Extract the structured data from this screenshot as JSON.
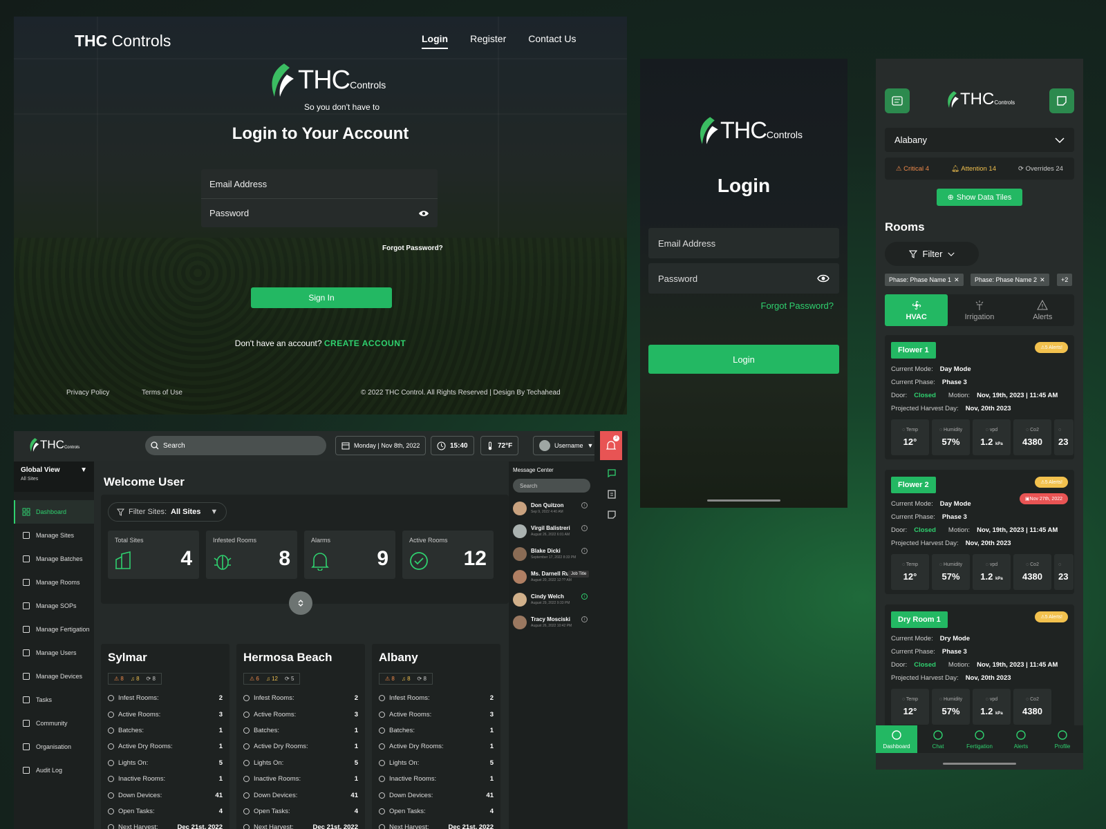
{
  "desktop_login": {
    "brand_bold": "THC",
    "brand_rest": " Controls",
    "nav": [
      "Login",
      "Register",
      "Contact Us"
    ],
    "logo_main": "THC",
    "logo_small": "Controls",
    "tagline": "So you don't have to",
    "title": "Login to Your Account",
    "email_placeholder": "Email Address",
    "password_placeholder": "Password",
    "forgot": "Forgot Password?",
    "sign_in": "Sign In",
    "no_account": "Don't have an account?",
    "create": "CREATE ACCOUNT",
    "footer": {
      "privacy": "Privacy Policy",
      "terms": "Terms of Use",
      "copyright": "© 2022 THC Control. All Rights Reserved | Design By Techahead"
    }
  },
  "mobile_login": {
    "logo_main": "THC",
    "logo_small": "Controls",
    "title": "Login",
    "email": "Email Address",
    "password": "Password",
    "forgot": "Forgot Password?",
    "button": "Login"
  },
  "dashboard": {
    "logo_main": "THC",
    "logo_small": "Controls",
    "search": "Search",
    "date": "Monday | Nov 8th, 2022",
    "time": "15:40",
    "temp": "72°F",
    "user": "Username",
    "bell_count": "3",
    "view": {
      "title": "Global View",
      "sub": "All Sites"
    },
    "nav": [
      "Dashboard",
      "Manage Sites",
      "Manage Batches",
      "Manage Rooms",
      "Manage SOPs",
      "Manage Fertigation",
      "Manage Users",
      "Manage Devices",
      "Tasks",
      "Community",
      "Organisation",
      "Audit Log"
    ],
    "welcome": "Welcome User",
    "filter_label": "Filter Sites:",
    "filter_value": "All Sites",
    "stats": [
      {
        "label": "Total Sites",
        "value": "4"
      },
      {
        "label": "Infested Rooms",
        "value": "8"
      },
      {
        "label": "Alarms",
        "value": "9"
      },
      {
        "label": "Active Rooms",
        "value": "12"
      }
    ],
    "sites": [
      {
        "name": "Sylmar",
        "badges": [
          "8",
          "8",
          "8"
        ],
        "rows": [
          [
            "Infest Rooms:",
            "2"
          ],
          [
            "Active Rooms:",
            "3"
          ],
          [
            "Batches:",
            "1"
          ],
          [
            "Active Dry Rooms:",
            "1"
          ],
          [
            "Lights On:",
            "5"
          ],
          [
            "Inactive Rooms:",
            "1"
          ],
          [
            "Down Devices:",
            "41"
          ],
          [
            "Open Tasks:",
            "4"
          ],
          [
            "Next Harvest:",
            "Dec 21st, 2022"
          ]
        ]
      },
      {
        "name": "Hermosa Beach",
        "badges": [
          "6",
          "12",
          "5"
        ],
        "rows": [
          [
            "Infest Rooms:",
            "2"
          ],
          [
            "Active Rooms:",
            "3"
          ],
          [
            "Batches:",
            "1"
          ],
          [
            "Active Dry Rooms:",
            "1"
          ],
          [
            "Lights On:",
            "5"
          ],
          [
            "Inactive Rooms:",
            "1"
          ],
          [
            "Down Devices:",
            "41"
          ],
          [
            "Open Tasks:",
            "4"
          ],
          [
            "Next Harvest:",
            "Dec 21st, 2022"
          ]
        ]
      },
      {
        "name": "Albany",
        "badges": [
          "8",
          "8",
          "8"
        ],
        "rows": [
          [
            "Infest Rooms:",
            "2"
          ],
          [
            "Active Rooms:",
            "3"
          ],
          [
            "Batches:",
            "1"
          ],
          [
            "Active Dry Rooms:",
            "1"
          ],
          [
            "Lights On:",
            "5"
          ],
          [
            "Inactive Rooms:",
            "1"
          ],
          [
            "Down Devices:",
            "41"
          ],
          [
            "Open Tasks:",
            "4"
          ],
          [
            "Next Harvest:",
            "Dec 21st, 2022"
          ]
        ]
      }
    ],
    "messages": {
      "title": "Message Center",
      "search": "Search",
      "tooltip": "Job Title",
      "items": [
        {
          "name": "Don Quitzon",
          "date": "Sep 9, 2022 4:40 AM"
        },
        {
          "name": "Virgil Balistreri",
          "date": "August 26, 2022 6:01 AM"
        },
        {
          "name": "Blake Dicki",
          "date": "September 17, 2022 8:33 PM"
        },
        {
          "name": "Ms. Darnell Ruec...",
          "date": "August 20, 2022 12:?? AM"
        },
        {
          "name": "Cindy Welch",
          "date": "August 29, 2022 9:33 PM"
        },
        {
          "name": "Tracy Mosciski",
          "date": "August 26, 2022 10:42 PM"
        }
      ]
    }
  },
  "mobile_rooms": {
    "logo_main": "THC",
    "logo_small": "Controls",
    "site": "Alabany",
    "alerts": [
      {
        "label": "Critical 4"
      },
      {
        "label": "Attention 14"
      },
      {
        "label": "Overrides 24"
      }
    ],
    "show_tiles": "Show Data Tiles",
    "rooms_title": "Rooms",
    "filter": "Filter",
    "chips": [
      "Phase: Phase Name 1",
      "Phase: Phase Name 2",
      "+2"
    ],
    "tabs": [
      "HVAC",
      "Irrigation",
      "Alerts"
    ],
    "labels": {
      "mode": "Current Mode:",
      "phase": "Current Phase:",
      "door": "Door:",
      "motion": "Motion:",
      "harvest": "Projected Harvest Day:"
    },
    "tile_labels": [
      "Temp",
      "Humidity",
      "vpd",
      "Co2",
      ""
    ],
    "cards": [
      {
        "name": "Flower 1",
        "alert": "5 Alerts!",
        "badge": "",
        "mode": "Day Mode",
        "phase": "Phase 3",
        "door": "Closed",
        "motion": "Nov, 19th, 2023 | 11:45 AM",
        "harvest": "Nov, 20th 2023",
        "tiles": [
          "12°",
          "57%",
          "1.2",
          "4380",
          "23"
        ]
      },
      {
        "name": "Flower 2",
        "alert": "5 Alerts!",
        "badge": "Nov 27th, 2022",
        "mode": "Day Mode",
        "phase": "Phase 3",
        "door": "Closed",
        "motion": "Nov, 19th, 2023 | 11:45 AM",
        "harvest": "Nov, 20th 2023",
        "tiles": [
          "12°",
          "57%",
          "1.2",
          "4380",
          "23"
        ]
      },
      {
        "name": "Dry Room 1",
        "alert": "5 Alerts!",
        "badge": "",
        "mode": "Dry Mode",
        "phase": "Phase 3",
        "door": "Closed",
        "motion": "Nov, 19th, 2023 | 11:45 AM",
        "harvest": "Nov, 20th 2023",
        "tiles": [
          "12°",
          "57%",
          "1.2",
          "4380",
          ""
        ]
      }
    ],
    "kpa": "kPa",
    "bottom": [
      "Dashboard",
      "Chat",
      "Fertigation",
      "Alerts",
      "Profile"
    ]
  },
  "colors": {
    "accent": "#23b863",
    "danger": "#e85454",
    "warning": "#f2c14e"
  }
}
